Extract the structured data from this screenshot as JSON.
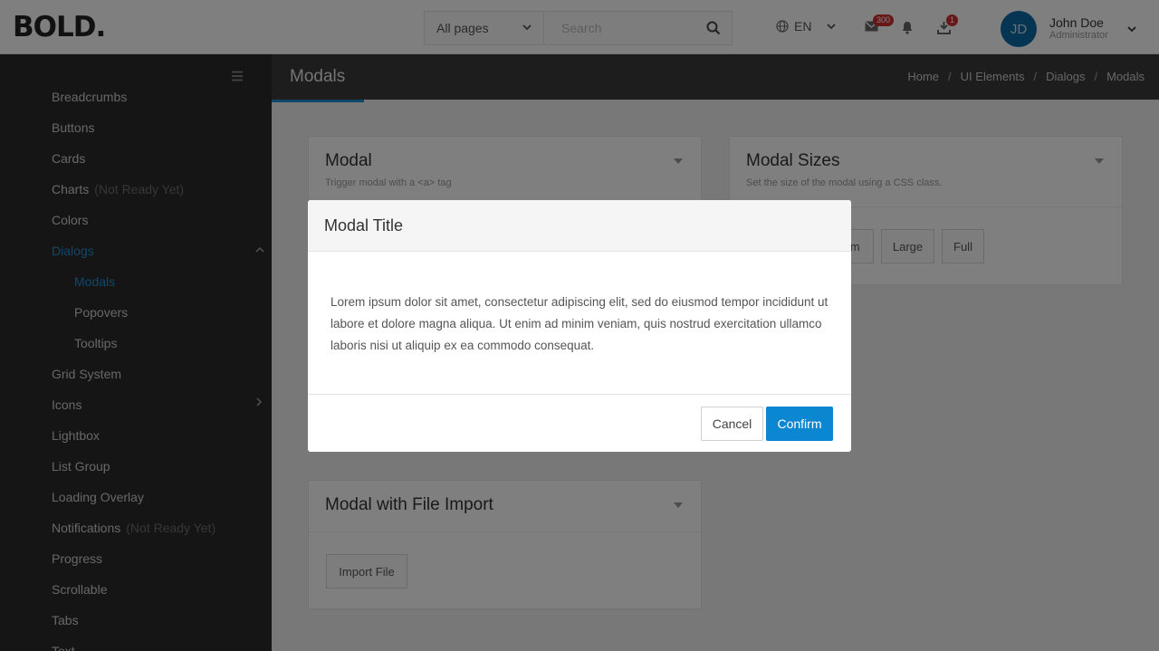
{
  "header": {
    "logo": "BOLD.",
    "search_scope": "All pages",
    "search_placeholder": "Search",
    "language": "EN",
    "messages_badge": "300",
    "downloads_badge": "1",
    "user": {
      "initials": "JD",
      "name": "John Doe",
      "role": "Administrator"
    }
  },
  "sidebar": {
    "items": [
      {
        "label": "Breadcrumbs"
      },
      {
        "label": "Buttons"
      },
      {
        "label": "Cards"
      },
      {
        "label": "Charts",
        "tag": "(Not Ready Yet)"
      },
      {
        "label": "Colors"
      },
      {
        "label": "Dialogs"
      },
      {
        "label": "Modals"
      },
      {
        "label": "Popovers"
      },
      {
        "label": "Tooltips"
      },
      {
        "label": "Grid System"
      },
      {
        "label": "Icons"
      },
      {
        "label": "Lightbox"
      },
      {
        "label": "List Group"
      },
      {
        "label": "Loading Overlay"
      },
      {
        "label": "Notifications",
        "tag": "(Not Ready Yet)"
      },
      {
        "label": "Progress"
      },
      {
        "label": "Scrollable"
      },
      {
        "label": "Tabs"
      },
      {
        "label": "Text"
      }
    ]
  },
  "page": {
    "title": "Modals",
    "breadcrumbs": [
      "Home",
      "UI Elements",
      "Dialogs",
      "Modals"
    ]
  },
  "cards": {
    "modal": {
      "title": "Modal",
      "subtitle": "Trigger modal with a <a> tag"
    },
    "sizes": {
      "title": "Modal Sizes",
      "subtitle": "Set the size of the modal using a CSS class.",
      "buttons": [
        "Medium",
        "Large",
        "Full"
      ]
    },
    "file_import": {
      "title": "Modal with File Import",
      "button": "Import File"
    }
  },
  "modal": {
    "title": "Modal Title",
    "body": "Lorem ipsum dolor sit amet, consectetur adipiscing elit, sed do eiusmod tempor incididunt ut labore et dolore magna aliqua. Ut enim ad minim veniam, quis nostrud exercitation ullamco laboris nisi ut aliquip ex ea commodo consequat.",
    "cancel": "Cancel",
    "confirm": "Confirm"
  },
  "colors": {
    "accent": "#1f8fd6",
    "primary_button": "#0b86d1",
    "badge": "#d12f2f"
  }
}
